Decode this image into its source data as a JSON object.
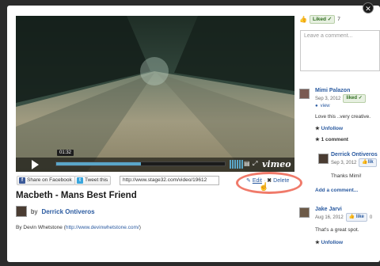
{
  "video": {
    "current_time": "01:32",
    "progress_fraction": 0.5,
    "brand": "vimeo"
  },
  "share": {
    "facebook_label": "Share on Facebook",
    "twitter_label": "Tweet this",
    "url": "http://www.stage32.com/video/19612",
    "edit_label": "Edit",
    "separator": "·",
    "delete_label": "Delete"
  },
  "main": {
    "title": "Macbeth - Mans Best Friend",
    "by_label": "by",
    "author": "Derrick Ontiveros",
    "credit_prefix": "By Devin Whetstone (",
    "credit_link": "http://www.devinwhetstone.com/",
    "credit_suffix": ")"
  },
  "sidebar": {
    "liked_label": "Liked ✓",
    "liked_count": "7",
    "comment_placeholder": "Leave a comment...",
    "comments": [
      {
        "name": "Mimi Palazon",
        "date": "Sep 3, 2012",
        "liked_label": "liked ✓",
        "view_label": "view",
        "body": "Love this ..very creative.",
        "unfollow_label": "Unfollow",
        "reply_count_label": "1 comment",
        "reply": {
          "name": "Derrick Ontiveros",
          "date": "Sep 3, 2012",
          "like_label": "lik",
          "body": "Thanks Mimi!"
        },
        "add_comment_label": "Add a comment..."
      },
      {
        "name": "Jake Jarvi",
        "date": "Aug 16, 2012",
        "like_label": "like",
        "like_count": "0",
        "body": "That's a great spot.",
        "unfollow_label": "Unfollow"
      }
    ]
  },
  "colors": {
    "link": "#2a5aa0",
    "highlight": "#f07a6a",
    "liked_green": "#2f6d1f",
    "player_accent": "#5aa6c8"
  },
  "icons": {
    "play": "play-icon",
    "facebook": "facebook-icon",
    "twitter": "twitter-icon",
    "edit": "edit-icon",
    "delete": "delete-icon",
    "star": "star-icon",
    "thumb": "thumbs-up-icon",
    "cursor": "hand-cursor-icon",
    "close": "close-icon"
  }
}
